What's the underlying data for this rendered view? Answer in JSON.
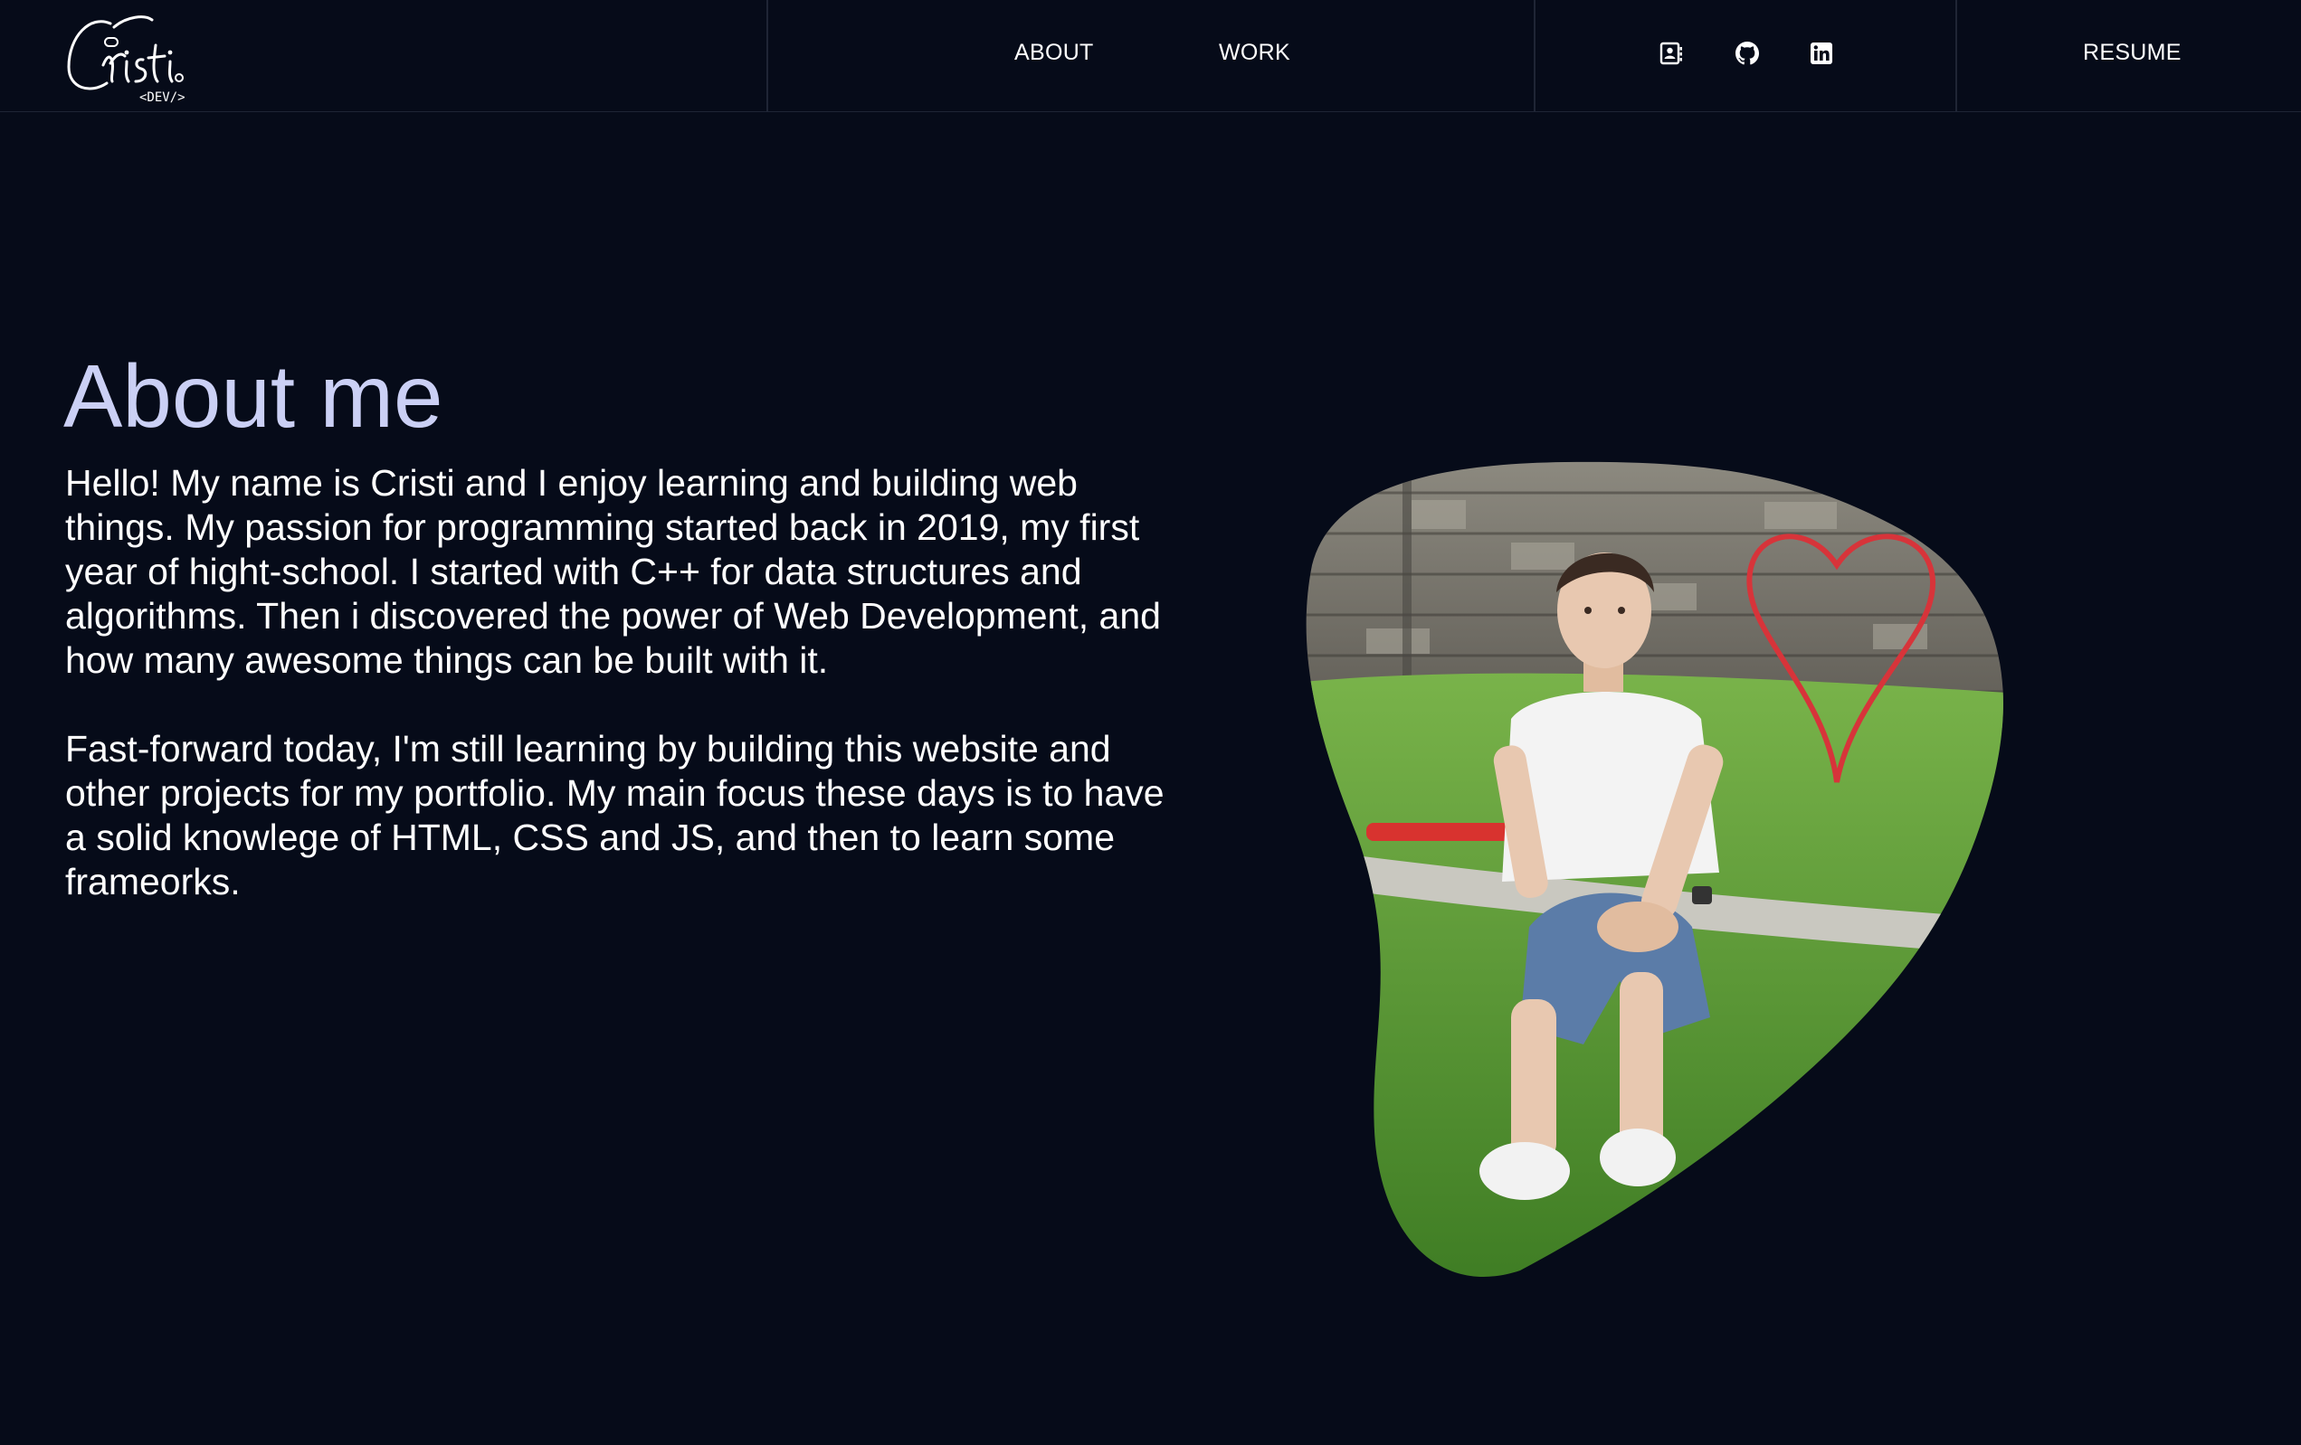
{
  "nav": {
    "logo": {
      "name": "Cristi",
      "tag": "<DEV/>"
    },
    "links": [
      {
        "label": "ABOUT"
      },
      {
        "label": "WORK"
      }
    ],
    "social_icons": [
      "contact-card-icon",
      "github-icon",
      "linkedin-icon"
    ],
    "resume_label": "RESUME"
  },
  "about": {
    "title": "About me",
    "paragraphs": [
      "Hello! My name is Cristi and I enjoy learning and building web things. My passion for programming started back in 2019, my first year of hight-school. I started with C++ for data structures and algorithms. Then i discovered the power of Web Development, and how many awesome things can be built with it.",
      "Fast-forward today, I'm still learning by building this website and other projects for my portfolio. My main focus these days is to have a solid knowlege of HTML, CSS and JS, and then to learn some frameorks."
    ]
  },
  "colors": {
    "background": "#060b19",
    "title": "#cbd0f5",
    "text": "#ffffff",
    "divider": "#1f2535"
  }
}
